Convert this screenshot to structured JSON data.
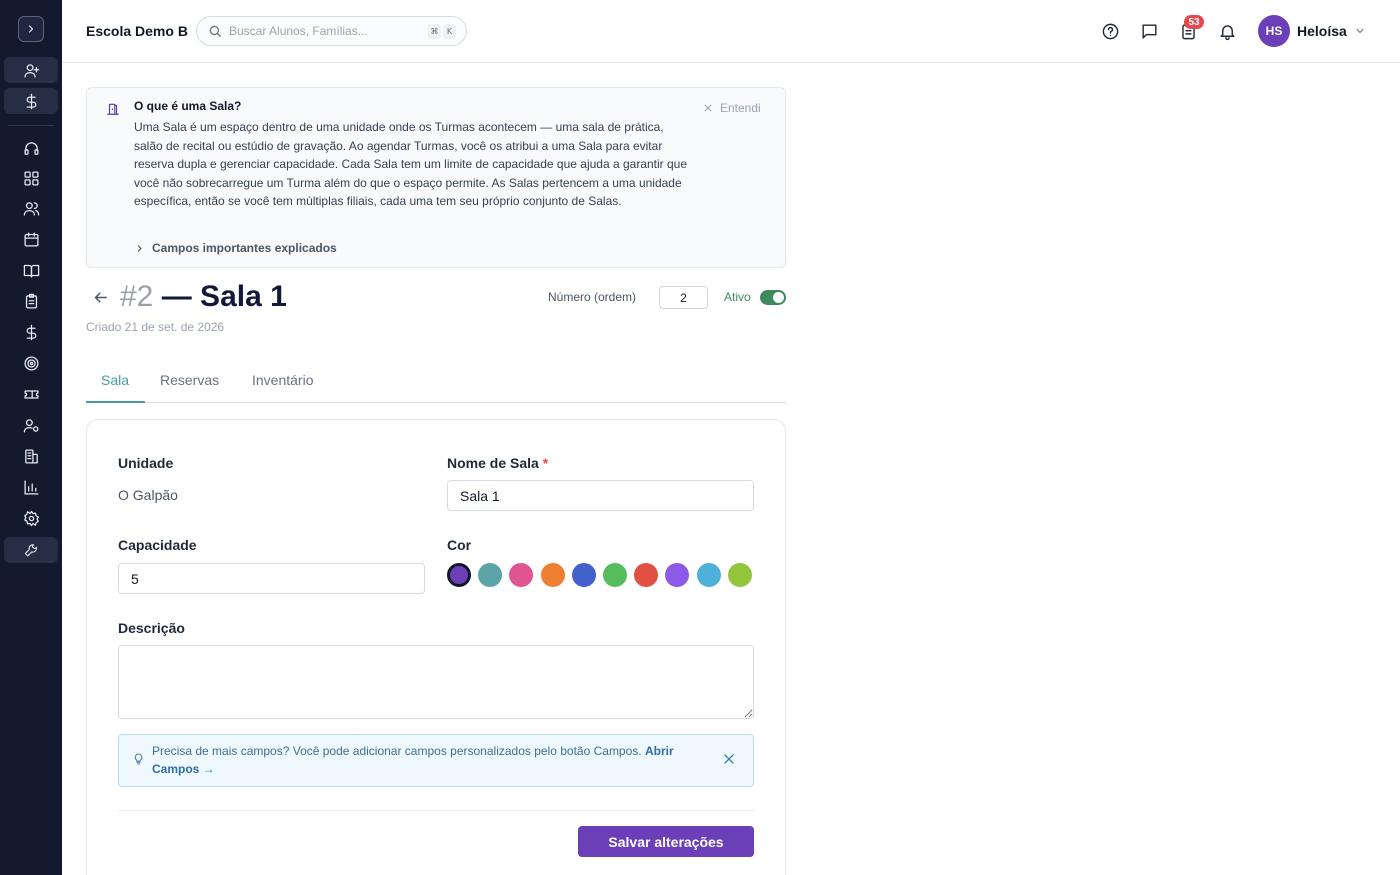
{
  "header": {
    "school_name": "Escola Demo B",
    "search_placeholder": "Buscar Alunos, Famílias...",
    "search_shortcut": [
      "⌘",
      "K"
    ],
    "notifications_badge": "53",
    "user_initials": "HS",
    "user_name": "Heloísa"
  },
  "sidebar": {
    "items": [
      "toggle-sidebar",
      "add-user",
      "finance",
      "support",
      "dashboard",
      "people",
      "calendar",
      "catalog",
      "attendance",
      "billing",
      "goals",
      "tickets",
      "staff",
      "units",
      "reports",
      "settings",
      "tools"
    ]
  },
  "info_panel": {
    "title": "O que é uma Sala?",
    "body": "Uma Sala é um espaço dentro de uma unidade onde os Turmas acontecem — uma sala de prática, salão de recital ou estúdio de gravação. Ao agendar Turmas, você os atribui a uma Sala para evitar reserva dupla e gerenciar capacidade. Cada Sala tem um limite de capacidade que ajuda a garantir que você não sobrecarregue um Turma além do que o espaço permite. As Salas pertencem a uma unidade específica, então se você tem múltiplas filiais, cada uma tem seu próprio conjunto de Salas.",
    "dismiss_label": "Entendi",
    "expand_label": "Campos importantes explicados"
  },
  "page": {
    "number": "#2",
    "title": "— Sala 1",
    "created": "Criado 21 de set. de 2026",
    "order_label": "Número (ordem)",
    "order_value": "2",
    "active_label": "Ativo",
    "active": true
  },
  "tabs": [
    {
      "label": "Sala",
      "active": true
    },
    {
      "label": "Reservas",
      "active": false
    },
    {
      "label": "Inventário",
      "active": false
    }
  ],
  "form": {
    "unit_label": "Unidade",
    "unit_value": "O Galpão",
    "name_label": "Nome de Sala",
    "name_required": "*",
    "name_value": "Sala 1",
    "capacity_label": "Capacidade",
    "capacity_value": "5",
    "color_label": "Cor",
    "colors": [
      "#6a3fb8",
      "#5aa3a6",
      "#e05494",
      "#ef7f33",
      "#4261cc",
      "#57bd5c",
      "#e15043",
      "#8d5ae8",
      "#4fb1d9",
      "#93c63d"
    ],
    "selected_color": 0,
    "description_label": "Descrição",
    "description_value": "",
    "tip_text": "Precisa de mais campos? Você pode adicionar campos personalizados pelo botão Campos.",
    "tip_link": "Abrir Campos →",
    "save_label": "Salvar alterações"
  }
}
